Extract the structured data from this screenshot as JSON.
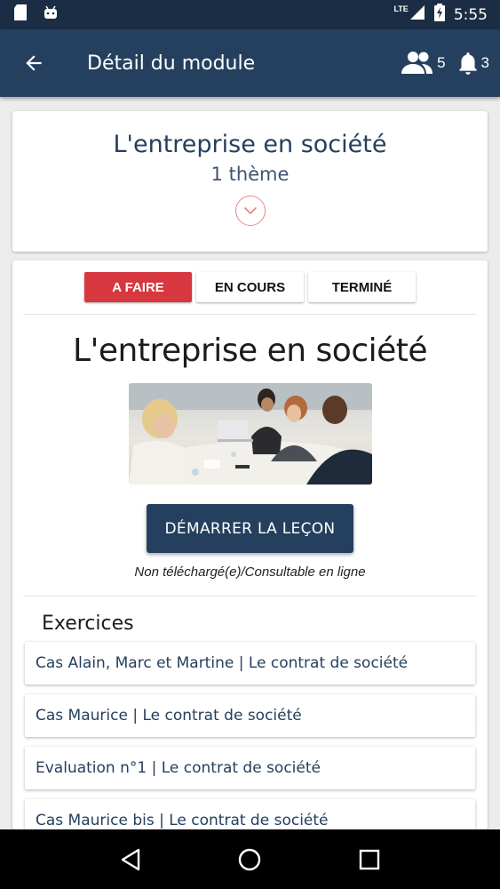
{
  "status": {
    "time": "5:55",
    "network": "LTE",
    "icons": [
      "sd-card-icon",
      "android-icon",
      "signal-icon",
      "battery-icon"
    ]
  },
  "appbar": {
    "title": "Détail du module",
    "group_count": "5",
    "notif_count": "3"
  },
  "module": {
    "title": "L'entreprise en société",
    "subtitle": "1 thème"
  },
  "tabs": [
    {
      "label": "A FAIRE",
      "active": true
    },
    {
      "label": "EN COURS",
      "active": false
    },
    {
      "label": "TERMINÉ",
      "active": false
    }
  ],
  "lesson": {
    "title": "L'entreprise en société",
    "start_label": "DÉMARRER LA LEÇON",
    "note": "Non téléchargé(e)/Consultable en ligne"
  },
  "exercises": {
    "header": "Exercices",
    "items": [
      "Cas Alain, Marc et Martine | Le contrat de société",
      "Cas Maurice | Le contrat de société",
      "Evaluation n°1 | Le contrat de société",
      "Cas Maurice bis | Le contrat de société"
    ]
  },
  "colors": {
    "appbar": "#25405e",
    "statusbar": "#1b2d45",
    "accent_red": "#d7373f",
    "button": "#25405e"
  }
}
